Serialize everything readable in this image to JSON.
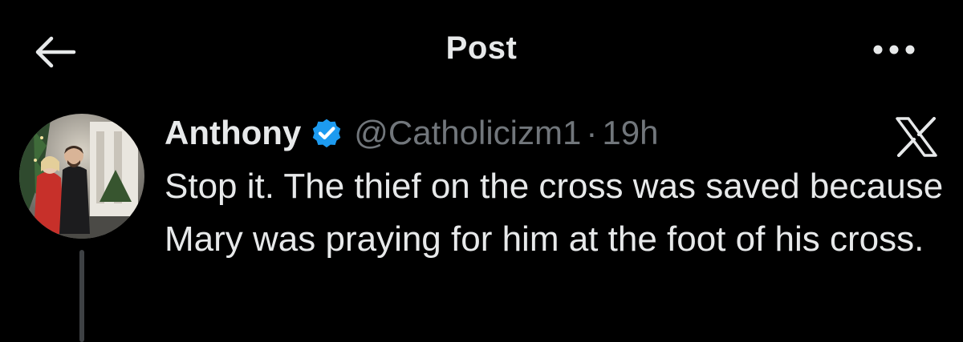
{
  "header": {
    "title": "Post",
    "back_icon": "arrow-left-icon",
    "more_icon": "more-horizontal-icon"
  },
  "tweet": {
    "display_name": "Anthony",
    "verified_icon": "verified-badge-icon",
    "handle": "@Catholicizm1",
    "separator": "·",
    "time": "19h",
    "platform_icon": "x-logo-icon",
    "text": "Stop it. The thief on the cross was saved because Mary was praying for him at the foot of his cross."
  },
  "colors": {
    "background": "#000000",
    "primary_text": "#e7e9ea",
    "secondary_text": "#71767b",
    "verified_blue": "#1d9bf0"
  }
}
